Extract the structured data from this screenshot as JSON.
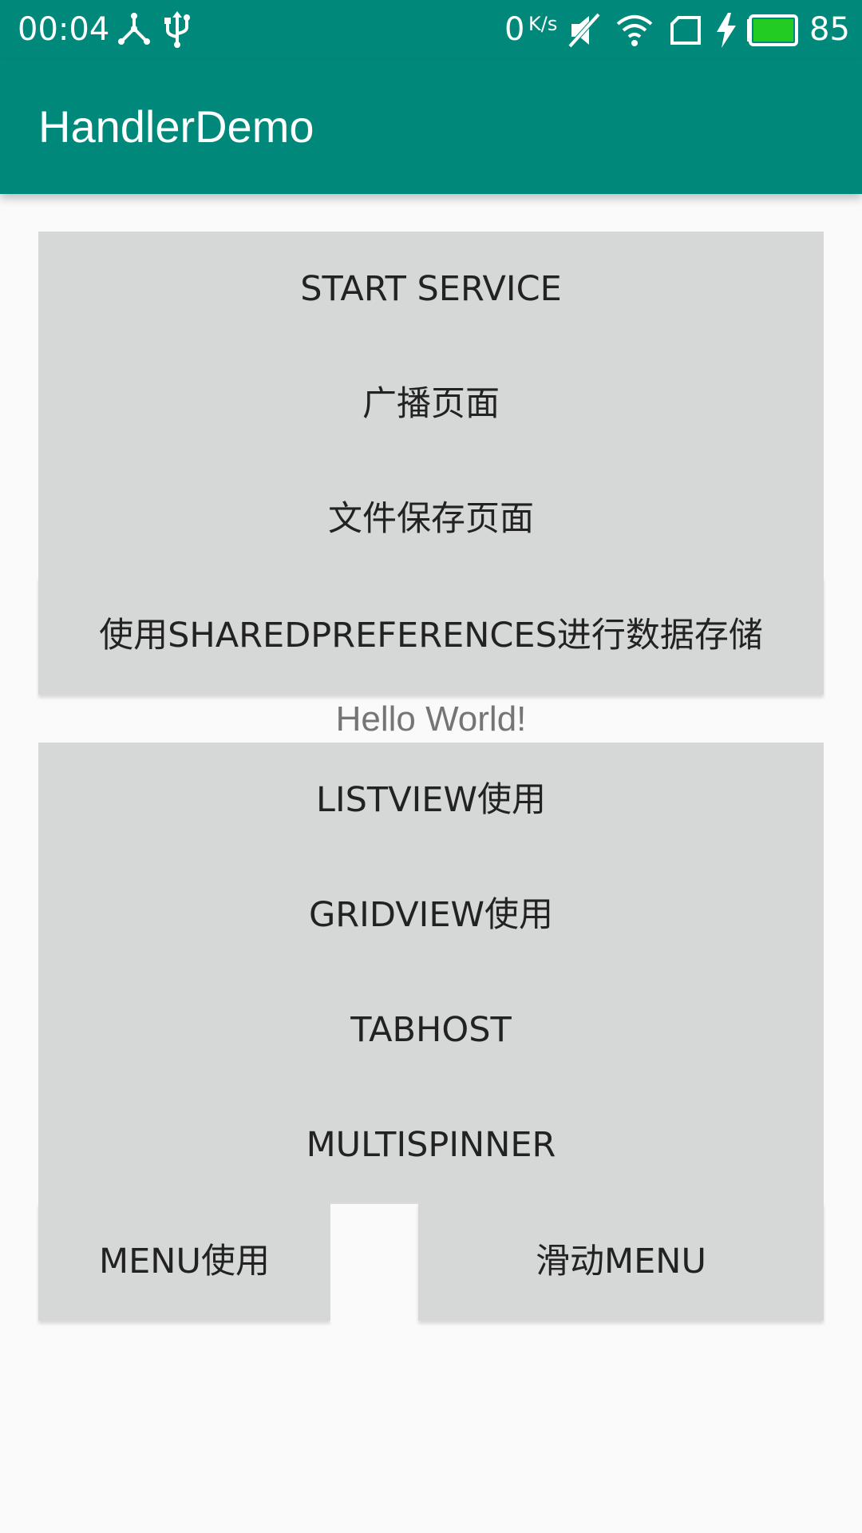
{
  "status_bar": {
    "time": "00:04",
    "net_speed_value": "0",
    "net_speed_unit": "K/s",
    "battery_level": "85",
    "icons": [
      "share-node-icon",
      "usb-icon",
      "mute-icon",
      "wifi-icon",
      "sim-icon",
      "charging-icon",
      "battery-icon"
    ],
    "battery_fill_color": "#22cc22"
  },
  "app_bar": {
    "title": "HandlerDemo",
    "color": "#00897b"
  },
  "buttons_group1": [
    {
      "label": "START SERVICE"
    },
    {
      "label": "广播页面"
    },
    {
      "label": "文件保存页面"
    },
    {
      "label": "使用SHAREDPREFERENCES进行数据存储"
    }
  ],
  "hello_text": "Hello World!",
  "buttons_group2": [
    {
      "label": "LISTVIEW使用"
    },
    {
      "label": "GRIDVIEW使用"
    },
    {
      "label": "TABHOST"
    },
    {
      "label": "MULTISPINNER"
    }
  ],
  "bottom_row": {
    "left_label": "MENU使用",
    "right_label": "滑动MENU"
  }
}
